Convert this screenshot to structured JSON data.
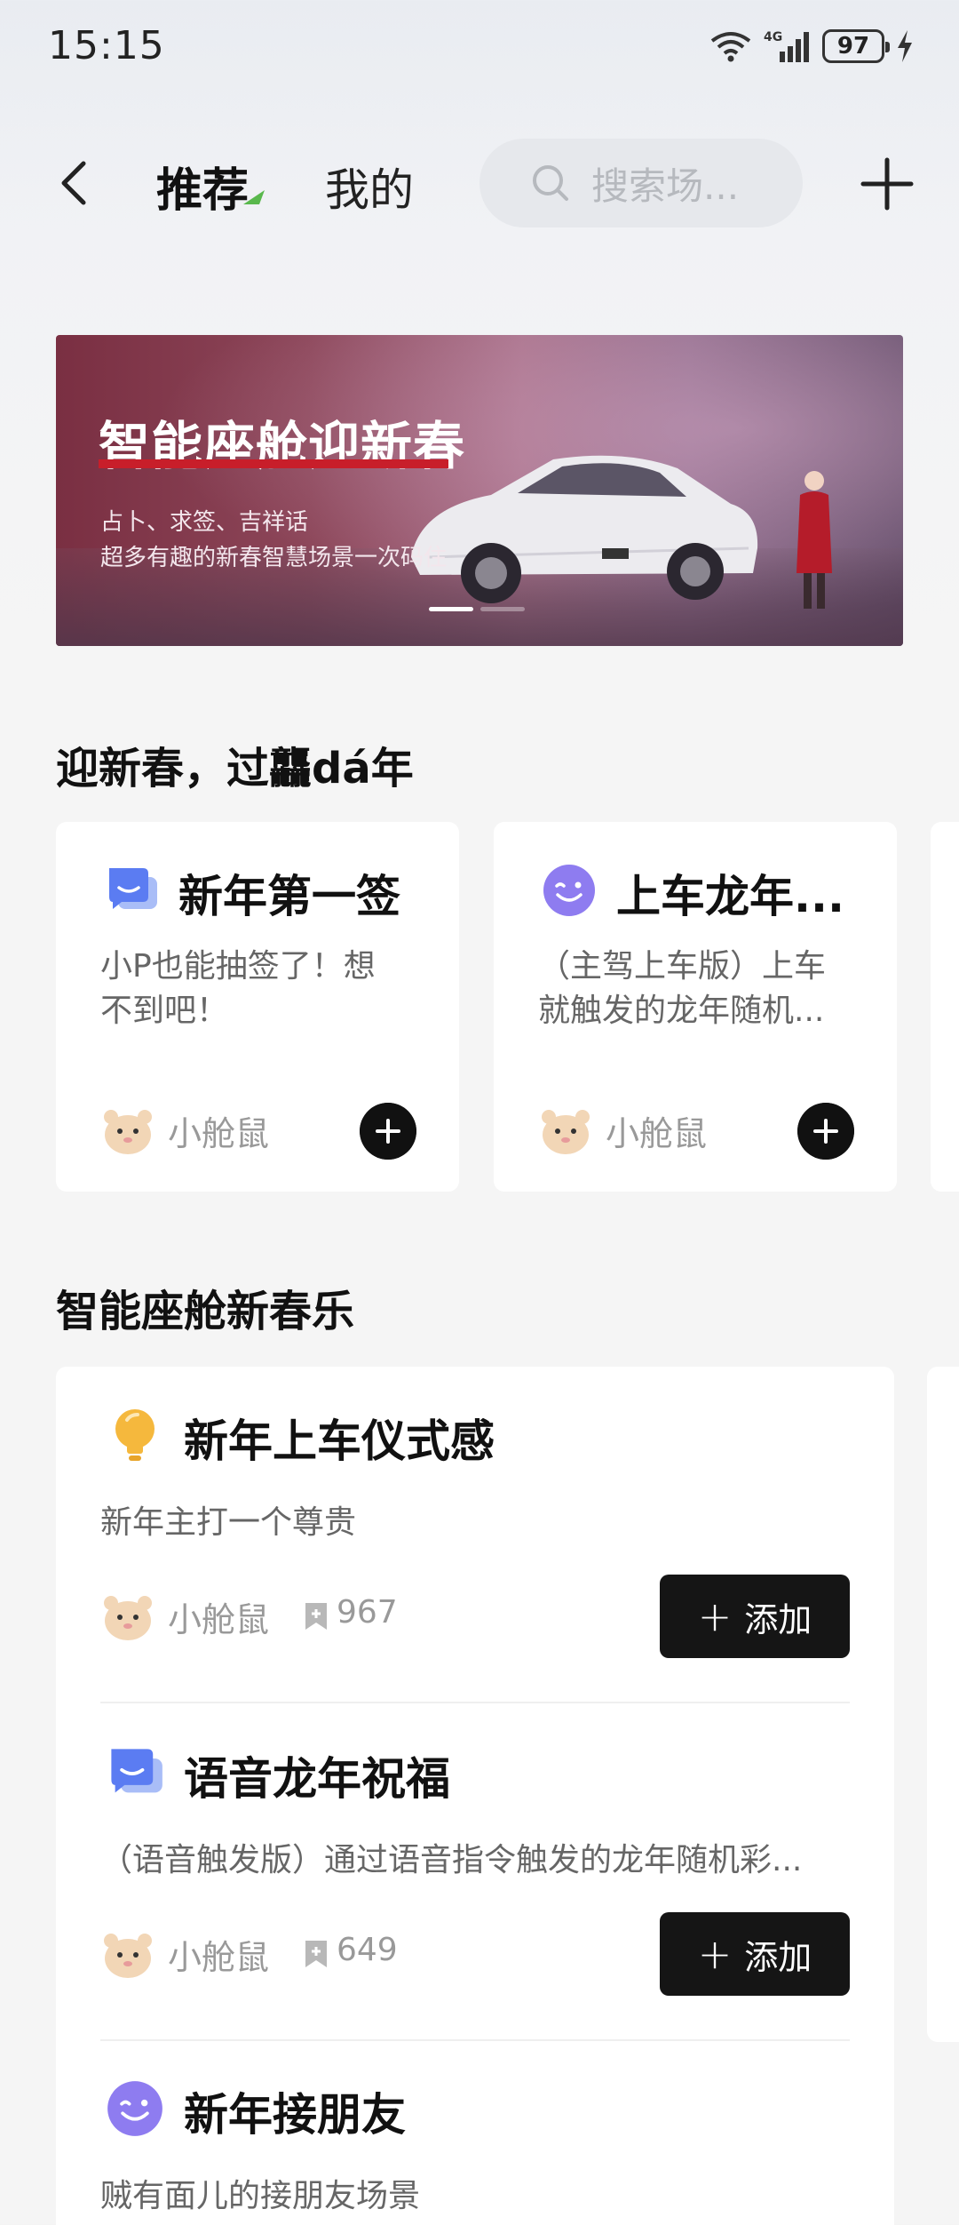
{
  "status_bar": {
    "time": "15:15",
    "battery": "97",
    "network": "4G"
  },
  "header": {
    "tabs": [
      {
        "label": "推荐",
        "active": true
      },
      {
        "label": "我的",
        "active": false
      }
    ],
    "search": {
      "placeholder": "搜索场..."
    }
  },
  "banner": {
    "title": "智能座舱迎新春",
    "subtitle_line1": "占卜、求签、吉祥话",
    "subtitle_line2": "超多有趣的新春智慧场景一次码住",
    "pages": 2,
    "active_page": 1
  },
  "section1": {
    "title": "迎新春，过龘dá年",
    "cards": [
      {
        "icon": "chat-bubble-icon",
        "title": "新年第一签",
        "desc_line1": "小P也能抽签了！想",
        "desc_line2": "不到吧！",
        "author": "小舱鼠"
      },
      {
        "icon": "wink-face-icon",
        "title": "上车龙年...",
        "desc_line1": "（主驾上车版）上车",
        "desc_line2": "就触发的龙年随机...",
        "author": "小舱鼠"
      }
    ]
  },
  "section2": {
    "title": "智能座舱新春乐",
    "items": [
      {
        "icon": "lightbulb-icon",
        "title": "新年上车仪式感",
        "desc": "新年主打一个尊贵",
        "author": "小舱鼠",
        "count": "967",
        "button": "添加"
      },
      {
        "icon": "chat-bubble-icon",
        "title": "语音龙年祝福",
        "desc": "（语音触发版）通过语音指令触发的龙年随机彩...",
        "author": "小舱鼠",
        "count": "649",
        "button": "添加"
      },
      {
        "icon": "wink-face-icon",
        "title": "新年接朋友",
        "desc": "贼有面儿的接朋友场景"
      }
    ]
  },
  "colors": {
    "accent_purple": "#8e7cf0",
    "chat_blue": "#5b7cf2",
    "bulb_yellow": "#f5b83d",
    "banner_red": "#c81e2a",
    "button_black": "#151515"
  }
}
